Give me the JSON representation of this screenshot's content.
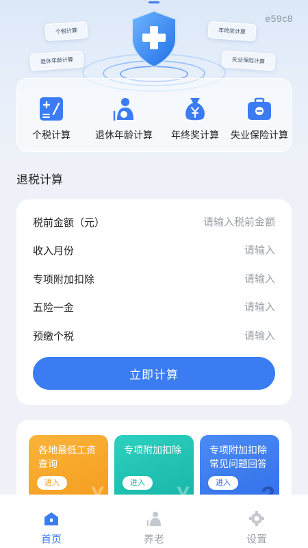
{
  "hero": {
    "code": "e59c8",
    "floating_tags": [
      "个税计算",
      "年终奖计算",
      "退休年龄计算",
      "失业保险计算"
    ]
  },
  "calculators": [
    {
      "label": "个税计算",
      "icon": "calculator-icon"
    },
    {
      "label": "退休年龄计算",
      "icon": "elderly-person-icon"
    },
    {
      "label": "年终奖计算",
      "icon": "money-bag-icon"
    },
    {
      "label": "失业保险计算",
      "icon": "briefcase-icon"
    }
  ],
  "refund": {
    "title": "退税计算",
    "fields": [
      {
        "label": "税前金额（元）",
        "placeholder": "请输入税前金额"
      },
      {
        "label": "收入月份",
        "placeholder": "请输入"
      },
      {
        "label": "专项附加扣除",
        "placeholder": "请输入"
      },
      {
        "label": "五险一金",
        "placeholder": "请输入"
      },
      {
        "label": "预缴个税",
        "placeholder": "请输入"
      }
    ],
    "button_label": "立即计算"
  },
  "features": [
    {
      "title": "各地最低工资查询",
      "enter_label": "进入",
      "color": "#f7a524"
    },
    {
      "title": "专项附加扣除",
      "enter_label": "进入",
      "color": "#1fc3b3"
    },
    {
      "title": "专项附加扣除常见问题回答",
      "enter_label": "进入",
      "color": "#3b7cf2"
    }
  ],
  "tabbar": {
    "tabs": [
      {
        "label": "首页",
        "active": true
      },
      {
        "label": "养老",
        "active": false
      },
      {
        "label": "设置",
        "active": false
      }
    ]
  },
  "colors": {
    "accent": "#3b7cf2",
    "background": "#eef2f8"
  }
}
